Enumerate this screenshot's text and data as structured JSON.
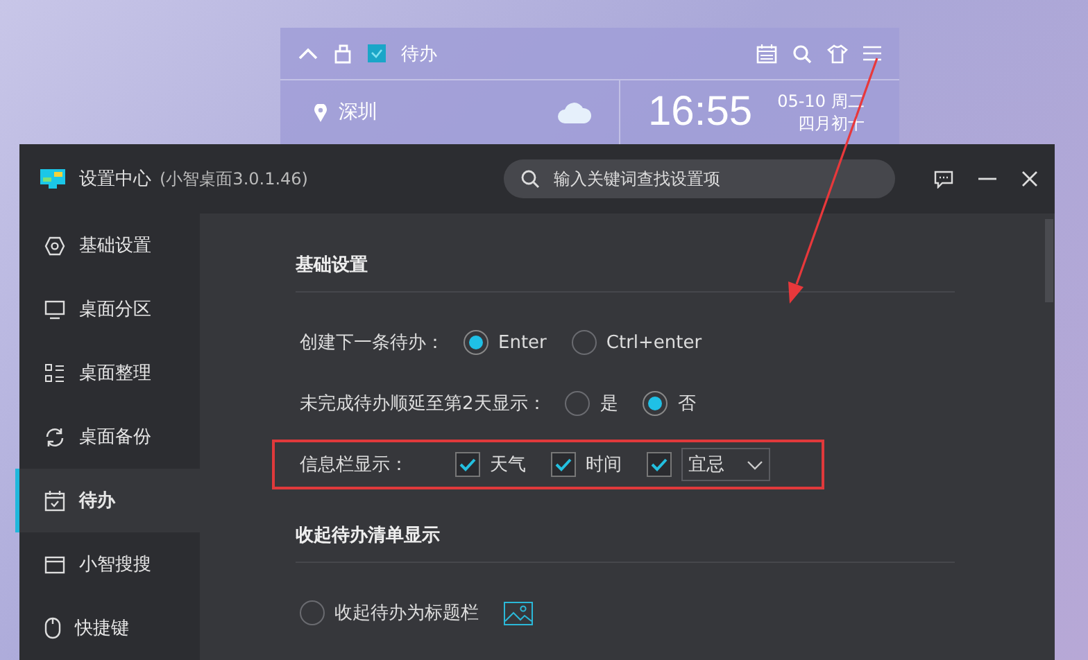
{
  "widget": {
    "title": "待办",
    "city": "深圳",
    "time": "16:55",
    "date": "05-10 周二",
    "lunar": "四月初十"
  },
  "window": {
    "title": "设置中心",
    "version": "(小智桌面3.0.1.46)",
    "search": {
      "placeholder": "输入关键词查找设置项"
    }
  },
  "sidebar": {
    "items": [
      {
        "label": "基础设置",
        "selected": false
      },
      {
        "label": "桌面分区",
        "selected": false
      },
      {
        "label": "桌面整理",
        "selected": false
      },
      {
        "label": "桌面备份",
        "selected": false
      },
      {
        "label": "待办",
        "selected": true
      },
      {
        "label": "小智搜搜",
        "selected": false
      },
      {
        "label": "快捷键",
        "selected": false
      }
    ]
  },
  "sections": [
    {
      "heading": "基础设置",
      "rows": [
        {
          "kind": "radio",
          "label": "创建下一条待办：",
          "highlighted": false,
          "options": [
            {
              "label": "Enter",
              "selected": true
            },
            {
              "label": "Ctrl+enter",
              "selected": false
            }
          ]
        },
        {
          "kind": "radio",
          "label": "未完成待办顺延至第2天显示：",
          "highlighted": false,
          "options": [
            {
              "label": "是",
              "selected": false
            },
            {
              "label": "否",
              "selected": true
            }
          ]
        },
        {
          "kind": "checks",
          "label": "信息栏显示：",
          "highlighted": true,
          "items": [
            {
              "kind": "check",
              "label": "天气",
              "checked": true
            },
            {
              "kind": "check",
              "label": "时间",
              "checked": true
            },
            {
              "kind": "select",
              "value": "宜忌",
              "checked": true
            }
          ]
        }
      ]
    },
    {
      "heading": "收起待办清单显示",
      "rows": [
        {
          "kind": "radio-preview",
          "highlighted": false,
          "options": [
            {
              "label": "收起待办为标题栏",
              "selected": false
            }
          ]
        }
      ]
    }
  ]
}
